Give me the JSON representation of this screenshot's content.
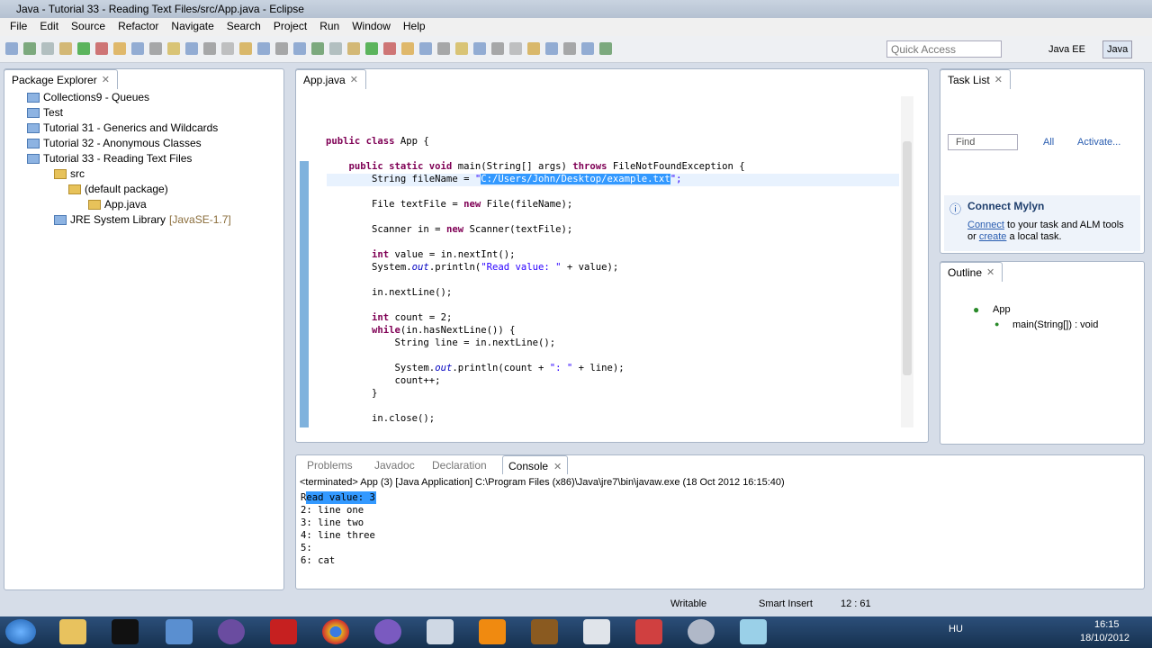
{
  "window": {
    "title": "Java - Tutorial 33 - Reading Text Files/src/App.java - Eclipse"
  },
  "menu": [
    "File",
    "Edit",
    "Source",
    "Refactor",
    "Navigate",
    "Search",
    "Project",
    "Run",
    "Window",
    "Help"
  ],
  "toolbar": {
    "quick_access_placeholder": "Quick Access",
    "perspectives": [
      "Java EE",
      "Java"
    ]
  },
  "package_explorer": {
    "title": "Package Explorer",
    "items": [
      {
        "label": "Collections9 - Queues",
        "type": "project"
      },
      {
        "label": "Test",
        "type": "project"
      },
      {
        "label": "Tutorial 31 - Generics and Wildcards",
        "type": "project"
      },
      {
        "label": "Tutorial 32 - Anonymous Classes",
        "type": "project"
      },
      {
        "label": "Tutorial 33 - Reading Text Files",
        "type": "project"
      },
      {
        "label": "src",
        "type": "folder"
      },
      {
        "label": "(default package)",
        "type": "package"
      },
      {
        "label": "App.java",
        "type": "file"
      },
      {
        "label": "JRE System Library",
        "type": "library",
        "suffix": "[JavaSE-1.7]"
      }
    ]
  },
  "editor": {
    "tab": "App.java",
    "lines": [
      [
        {
          "t": "public class ",
          "c": "kw"
        },
        {
          "t": "App {",
          "c": ""
        }
      ],
      [],
      [
        {
          "t": "    public static void ",
          "c": "kw"
        },
        {
          "t": "main(String[] args) ",
          "c": ""
        },
        {
          "t": "throws ",
          "c": "kw"
        },
        {
          "t": "FileNotFoundException {",
          "c": ""
        }
      ],
      [
        {
          "t": "        String fileName = ",
          "c": ""
        },
        {
          "t": "\"",
          "c": "str"
        },
        {
          "t": "C:/Users/John/Desktop/example.txt",
          "c": "sel"
        },
        {
          "t": "\";",
          "c": "str"
        }
      ],
      [],
      [
        {
          "t": "        File textFile = ",
          "c": ""
        },
        {
          "t": "new ",
          "c": "kw"
        },
        {
          "t": "File(fileName);",
          "c": ""
        }
      ],
      [],
      [
        {
          "t": "        Scanner in = ",
          "c": ""
        },
        {
          "t": "new ",
          "c": "kw"
        },
        {
          "t": "Scanner(textFile);",
          "c": ""
        }
      ],
      [],
      [
        {
          "t": "        ",
          "c": ""
        },
        {
          "t": "int ",
          "c": "kw"
        },
        {
          "t": "value = in.nextInt();",
          "c": ""
        }
      ],
      [
        {
          "t": "        System.",
          "c": ""
        },
        {
          "t": "out",
          "c": "it"
        },
        {
          "t": ".println(",
          "c": ""
        },
        {
          "t": "\"Read value: \"",
          "c": "str"
        },
        {
          "t": " + value);",
          "c": ""
        }
      ],
      [],
      [
        {
          "t": "        in.nextLine();",
          "c": ""
        }
      ],
      [],
      [
        {
          "t": "        ",
          "c": ""
        },
        {
          "t": "int ",
          "c": "kw"
        },
        {
          "t": "count = 2;",
          "c": ""
        }
      ],
      [
        {
          "t": "        ",
          "c": ""
        },
        {
          "t": "while",
          "c": "kw"
        },
        {
          "t": "(in.hasNextLine()) {",
          "c": ""
        }
      ],
      [
        {
          "t": "            String line = in.nextLine();",
          "c": ""
        }
      ],
      [],
      [
        {
          "t": "            System.",
          "c": ""
        },
        {
          "t": "out",
          "c": "it"
        },
        {
          "t": ".println(count + ",
          "c": ""
        },
        {
          "t": "\": \"",
          "c": "str"
        },
        {
          "t": " + line);",
          "c": ""
        }
      ],
      [
        {
          "t": "            count++;",
          "c": ""
        }
      ],
      [
        {
          "t": "        }",
          "c": ""
        }
      ],
      [],
      [
        {
          "t": "        in.close();",
          "c": ""
        }
      ]
    ]
  },
  "task_list": {
    "title": "Task List",
    "find_placeholder": "Find",
    "all": "All",
    "activate": "Activate..."
  },
  "mylyn": {
    "title": "Connect Mylyn",
    "connect": "Connect",
    "text1": " to your task and ALM tools",
    "or": "or ",
    "create": "create",
    "text2": " a local task."
  },
  "outline": {
    "title": "Outline",
    "class": "App",
    "method": "main(String[]) : void"
  },
  "bottom_tabs": [
    "Problems",
    "Javadoc",
    "Declaration",
    "Console"
  ],
  "console": {
    "header": "<terminated> App (3) [Java Application] C:\\Program Files (x86)\\Java\\jre7\\bin\\javaw.exe (18 Oct 2012 16:15:40)",
    "lines": [
      "Read value: 3",
      "2: line one",
      "3: line two",
      "4: line three",
      "5:",
      "6: cat"
    ]
  },
  "status": {
    "writable": "Writable",
    "insert": "Smart Insert",
    "position": "12 : 61"
  },
  "taskbar": {
    "lang": "HU",
    "time": "16:15",
    "date": "18/10/2012"
  },
  "colors": {
    "keyword": "#7f0055",
    "string": "#2a00ff",
    "selection": "#3399ff"
  }
}
